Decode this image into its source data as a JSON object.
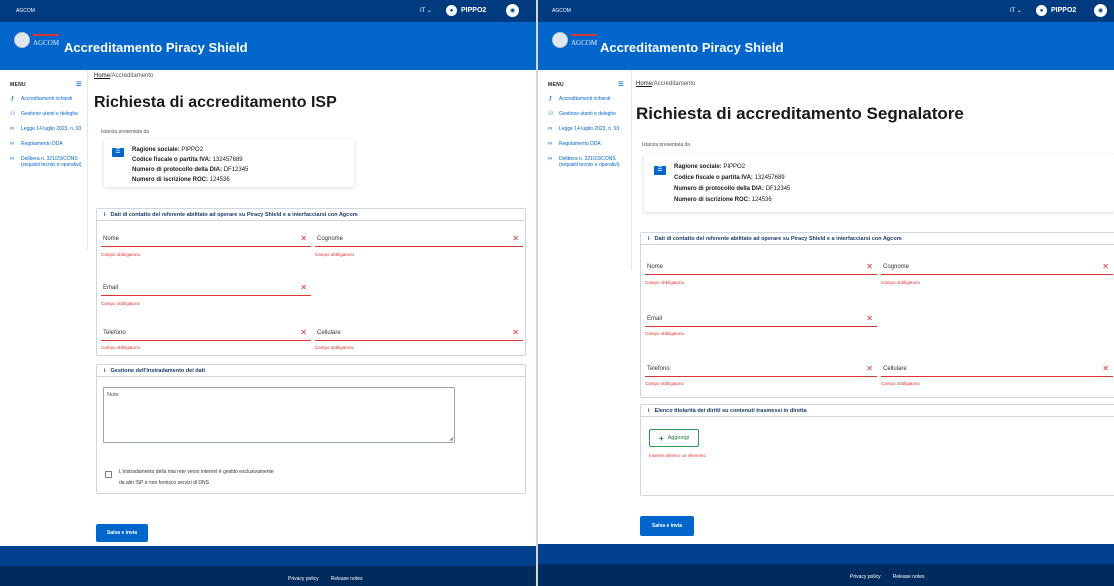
{
  "topbar": {
    "brand": "AGCOM",
    "lang": "IT",
    "user": "PIPPO2"
  },
  "logo_text": "AGCOM",
  "app_title": "Accreditamento Piracy Shield",
  "sidebar": {
    "menu_label": "MENU",
    "items": [
      {
        "icon": "key-icon",
        "label": "Accreditamenti richiesti"
      },
      {
        "icon": "users-icon",
        "label": "Gestione utenti e deleghe"
      },
      {
        "icon": "link-icon",
        "label": "Legge 14 luglio 2023, n. 93"
      },
      {
        "icon": "link-icon",
        "label": "Regolamento DDA"
      },
      {
        "icon": "link-icon",
        "label": "Delibera n. 321/23/CONS",
        "sub": "(requisiti tecnici e operativi)"
      }
    ]
  },
  "breadcrumb": {
    "home": "Home",
    "current": "/Accreditamento"
  },
  "istanza_label": "Istanza presentata da",
  "info_card": [
    {
      "key": "Ragione sociale:",
      "value": "PIPPO2"
    },
    {
      "key": "Codice fiscale o partita IVA:",
      "value": "132457689"
    },
    {
      "key": "Numero di protocollo della DIA:",
      "value": "DF12345"
    },
    {
      "key": "Numero di iscrizione ROC:",
      "value": "124536"
    }
  ],
  "contact_section_title": "Dati di contatto del referente abilitato ad operare su Piracy Shield e a interfacciarsi con Agcom",
  "fields": {
    "nome": "Nome",
    "cognome": "Cognome",
    "email": "Email",
    "telefono": "Telefono",
    "cellulare": "Cellulare"
  },
  "required_error": "Campo obbligatorio",
  "left": {
    "page_title": "Richiesta di accreditamento ISP",
    "routing_section_title": "Gestione dell'instradamento dei dati",
    "note_label": "Note",
    "checkbox_line1": "L'instradamento della mia rete verso internet è gestito esclusivamente",
    "checkbox_line2": "da altri ISP e non fornisco servizi di DNS",
    "submit": "Salva e invia"
  },
  "right": {
    "page_title": "Richiesta di accreditamento Segnalatore",
    "rights_section_title": "Elenco titolarità dei diritti su contenuti trasmessi in diretta",
    "add_button": "Aggiungi",
    "add_error": "Inserire almeno un elemento",
    "submit": "Salva e invia"
  },
  "footer": {
    "privacy": "Privacy policy",
    "release": "Release notes"
  },
  "colors": {
    "topbar": "#003b80",
    "header": "#0066cc",
    "error": "#d93333",
    "footer": "#002b5e",
    "add": "#2e9b54"
  }
}
